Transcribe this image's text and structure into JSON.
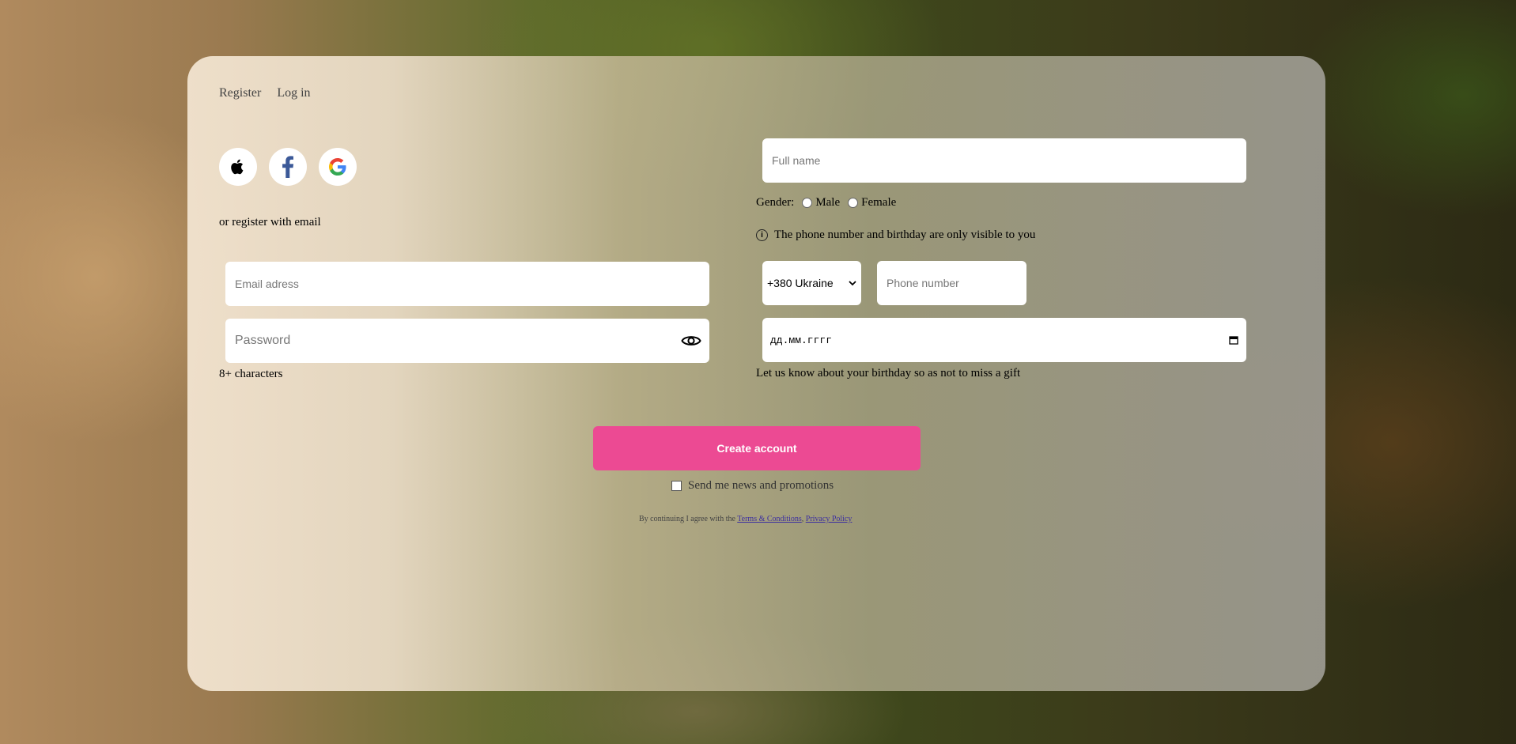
{
  "tabs": {
    "register": "Register",
    "login": "Log in"
  },
  "social": {
    "apple": "apple-icon",
    "facebook": "facebook-icon",
    "google": "google-icon"
  },
  "or_register": "or register with email",
  "email": {
    "placeholder": "Email adress"
  },
  "password": {
    "placeholder": "Password",
    "hint": "8+ characters"
  },
  "full_name": {
    "placeholder": "Full name"
  },
  "gender": {
    "label": "Gender:",
    "male": "Male",
    "female": "Female"
  },
  "privacy_note": "The phone number and birthday are only visible to you",
  "phone": {
    "country_code": "+380 Ukraine",
    "placeholder": "Phone number"
  },
  "birthday": {
    "placeholder": "дд.мм.гггг",
    "hint": "Let us know about your birthday so as not to miss a gift"
  },
  "create_button": "Create account",
  "newsletter": "Send me news and promotions",
  "legal": {
    "prefix": "By continuing I agree with the ",
    "terms": "Terms & Conditions",
    "separator": ", ",
    "privacy": "Privacy Policy"
  },
  "colors": {
    "accent": "#ec4a93"
  }
}
